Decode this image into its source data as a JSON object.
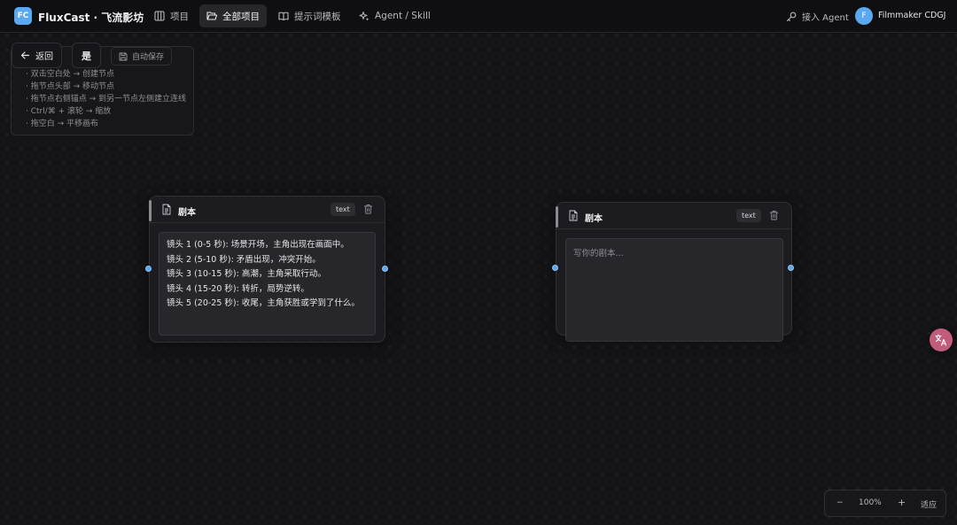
{
  "app": {
    "logo": "FC",
    "title": "FluxCast · 飞流影坊"
  },
  "nav": [
    {
      "label": "项目",
      "icon": "grid-icon",
      "active": false
    },
    {
      "label": "全部项目",
      "icon": "folder-open-icon",
      "active": true
    },
    {
      "label": "提示词模板",
      "icon": "book-icon",
      "active": false
    },
    {
      "label": "Agent / Skill",
      "icon": "sparkle-icon",
      "active": false
    }
  ],
  "header_right": {
    "agent_label": "接入 Agent",
    "avatar_initial": "F",
    "user_name": "Filmmaker CDGJ"
  },
  "toolbar": {
    "back_label": "返回",
    "confirm_label": "是",
    "autosave_label": "自动保存"
  },
  "help": {
    "items": [
      "· 双击空白处 → 创建节点",
      "· 拖节点头部 → 移动节点",
      "· 拖节点右侧锚点 → 到另一节点左侧建立连线",
      "· Ctrl/⌘ + 滚轮 → 缩放",
      "· 拖空白 → 平移画布"
    ]
  },
  "nodes": [
    {
      "title": "剧本",
      "badge": "text",
      "lines": [
        "镜头 1 (0-5 秒): 场景开场，主角出现在画面中。",
        "镜头 2 (5-10 秒): 矛盾出现，冲突开始。",
        "镜头 3 (10-15 秒): 高潮，主角采取行动。",
        "镜头 4 (15-20 秒): 转折，局势逆转。",
        "镜头 5 (20-25 秒): 收尾，主角获胜或学到了什么。"
      ]
    },
    {
      "title": "剧本",
      "badge": "text",
      "placeholder": "写你的剧本..."
    }
  ],
  "zoom": {
    "minus": "−",
    "level": "100%",
    "plus": "+",
    "fit": "适应"
  },
  "colors": {
    "accent": "#5aa9f0",
    "background": "#141416",
    "node": "#1c1c20",
    "float_button": "#c25c7a"
  }
}
